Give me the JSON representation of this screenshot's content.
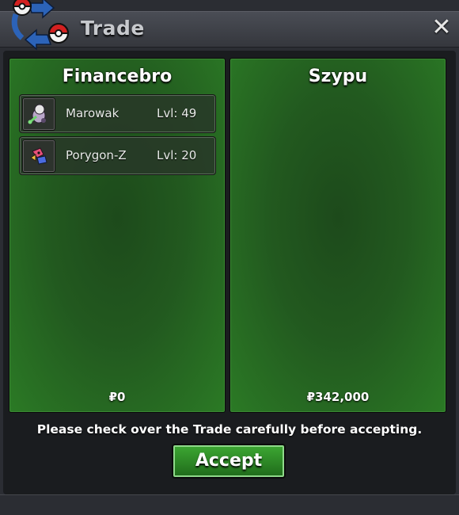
{
  "window": {
    "title": "Trade",
    "close_label": "✕"
  },
  "left_panel": {
    "player": "Financebro",
    "items": [
      {
        "name": "Marowak",
        "level": "Lvl: 49",
        "icon": "marowak-sprite-icon"
      },
      {
        "name": "Porygon-Z",
        "level": "Lvl: 20",
        "icon": "porygon-z-sprite-icon"
      }
    ],
    "money": "₽0"
  },
  "right_panel": {
    "player": "Szypu",
    "items": [],
    "money": "₽342,000"
  },
  "notice": "Please check over the Trade carefully before accepting.",
  "accept_label": "Accept",
  "colors": {
    "panel_green": "#22591f",
    "accept_green": "#3da833"
  }
}
